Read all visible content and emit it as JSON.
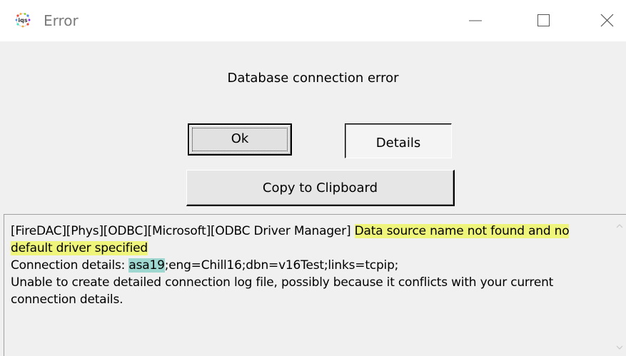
{
  "window": {
    "title": "Error",
    "app_icon": "iqs-logo-icon",
    "controls": [
      "minimize-icon",
      "maximize-icon",
      "close-icon"
    ]
  },
  "dialog": {
    "message": "Database connection error",
    "buttons": {
      "ok": "Ok",
      "details": "Details",
      "copy": "Copy to Clipboard"
    }
  },
  "log": {
    "line1_prefix": "[FireDAC][Phys][ODBC][Microsoft][ODBC Driver Manager] ",
    "line1_highlight": "Data source name not found and no default driver specified",
    "line2_prefix": "Connection details: ",
    "line2_highlight": "asa19",
    "line2_rest": ";eng=Chill16;dbn=v16Test;links=tcpip;",
    "line3": "Unable to create detailed connection log file, possibly because it conflicts with your current connection details."
  },
  "colors": {
    "highlight_yellow": "#eef57a",
    "highlight_teal": "#9ed6d0",
    "background": "#f0f0f0"
  }
}
